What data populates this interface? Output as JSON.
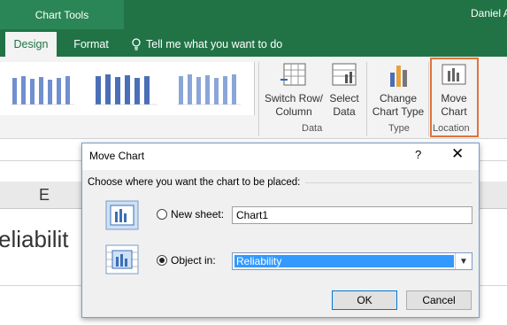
{
  "ribbon": {
    "contextual_title": "Chart Tools",
    "user": "Daniel A",
    "tabs": [
      {
        "label": "Design"
      },
      {
        "label": "Format"
      }
    ],
    "tell_me": "Tell me what you want to do",
    "buttons": {
      "switch_row": "Switch Row/ Column",
      "select_data": "Select Data",
      "change_type": "Change Chart Type",
      "move_chart": "Move Chart"
    },
    "groups": {
      "data": "Data",
      "type": "Type",
      "location": "Location"
    },
    "highlight_color": "#e0733a"
  },
  "sheet": {
    "column_e": "E",
    "cell_text": "eliabilit"
  },
  "dialog": {
    "title": "Move Chart",
    "help": "?",
    "close": "✕",
    "prompt": "Choose where you want the chart to be placed:",
    "new_sheet_label": "New sheet:",
    "new_sheet_value": "Chart1",
    "object_in_label": "Object in:",
    "object_in_value": "Reliability",
    "selected_option": "object_in",
    "ok": "OK",
    "cancel": "Cancel"
  }
}
